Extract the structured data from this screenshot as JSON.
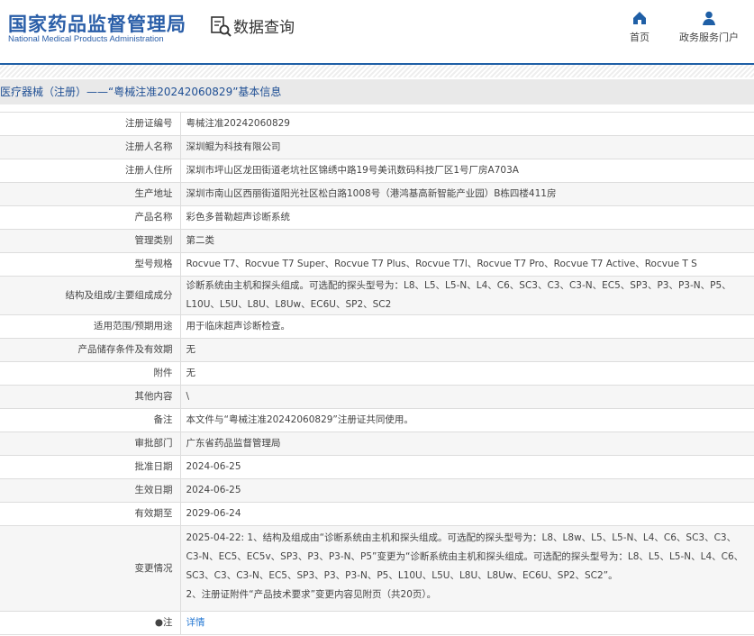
{
  "header": {
    "logo_cn": "国家药品监督管理局",
    "logo_en": "National Medical Products Administration",
    "query_title": "数据查询",
    "nav": [
      {
        "label": "首页",
        "icon": "home-icon"
      },
      {
        "label": "政务服务门户",
        "icon": "user-icon"
      }
    ]
  },
  "breadcrumb": "医疗器械（注册）——“粤械注准20242060829”基本信息",
  "rows": [
    {
      "label": "注册证编号",
      "value": "粤械注准20242060829"
    },
    {
      "label": "注册人名称",
      "value": "深圳鲲为科技有限公司"
    },
    {
      "label": "注册人住所",
      "value": "深圳市坪山区龙田街道老坑社区锦绣中路19号美讯数码科技厂区1号厂房A703A"
    },
    {
      "label": "生产地址",
      "value": "深圳市南山区西丽街道阳光社区松白路1008号（港鸿基高新智能产业园）B栋四楼411房"
    },
    {
      "label": "产品名称",
      "value": "彩色多普勒超声诊断系统"
    },
    {
      "label": "管理类别",
      "value": "第二类"
    },
    {
      "label": "型号规格",
      "value": "Rocvue T7、Rocvue T7 Super、Rocvue T7 Plus、Rocvue T7l、Rocvue T7 Pro、Rocvue T7 Active、Rocvue T S"
    },
    {
      "label": "结构及组成/主要组成成分",
      "value": "诊断系统由主机和探头组成。可选配的探头型号为：L8、L5、L5-N、L4、C6、SC3、C3、C3-N、EC5、SP3、P3、P3-N、P5、L10U、L5U、L8U、L8Uw、EC6U、SP2、SC2"
    },
    {
      "label": "适用范围/预期用途",
      "value": "用于临床超声诊断检查。"
    },
    {
      "label": "产品储存条件及有效期",
      "value": "无"
    },
    {
      "label": "附件",
      "value": "无"
    },
    {
      "label": "其他内容",
      "value": "\\"
    },
    {
      "label": "备注",
      "value": "本文件与“粤械注准20242060829”注册证共同使用。"
    },
    {
      "label": "审批部门",
      "value": "广东省药品监督管理局"
    },
    {
      "label": "批准日期",
      "value": "2024-06-25"
    },
    {
      "label": "生效日期",
      "value": "2024-06-25"
    },
    {
      "label": "有效期至",
      "value": "2029-06-24"
    },
    {
      "label": "变更情况",
      "value": "2025-04-22: 1、结构及组成由“诊断系统由主机和探头组成。可选配的探头型号为：L8、L8w、L5、L5-N、L4、C6、SC3、C3、C3-N、EC5、EC5v、SP3、P3、P3-N、P5”变更为“诊断系统由主机和探头组成。可选配的探头型号为：L8、L5、L5-N、L4、C6、SC3、C3、C3-N、EC5、SP3、P3、P3-N、P5、L10U、L5U、L8U、L8Uw、EC6U、SP2、SC2”。",
      "value2": "2、注册证附件“产品技术要求”变更内容见附页（共20页）。"
    },
    {
      "label": "●注",
      "value": "详情"
    }
  ]
}
